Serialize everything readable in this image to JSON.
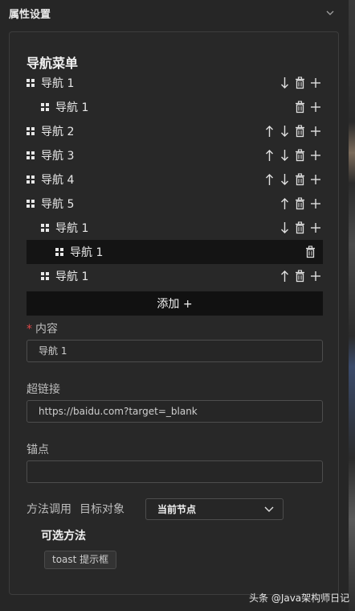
{
  "header": {
    "title": "属性设置"
  },
  "menu": {
    "title": "导航菜单",
    "items": [
      {
        "label": "导航 1",
        "level": 0,
        "up": false,
        "down": true,
        "add": true,
        "selected": false
      },
      {
        "label": "导航 1",
        "level": 1,
        "up": false,
        "down": false,
        "add": true,
        "selected": false
      },
      {
        "label": "导航 2",
        "level": 0,
        "up": true,
        "down": true,
        "add": true,
        "selected": false
      },
      {
        "label": "导航 3",
        "level": 0,
        "up": true,
        "down": true,
        "add": true,
        "selected": false
      },
      {
        "label": "导航 4",
        "level": 0,
        "up": true,
        "down": true,
        "add": true,
        "selected": false
      },
      {
        "label": "导航 5",
        "level": 0,
        "up": true,
        "down": false,
        "add": true,
        "selected": false
      },
      {
        "label": "导航 1",
        "level": 1,
        "up": false,
        "down": true,
        "add": true,
        "selected": false
      },
      {
        "label": "导航 1",
        "level": 2,
        "up": false,
        "down": false,
        "add": false,
        "selected": true
      },
      {
        "label": "导航 1",
        "level": 1,
        "up": true,
        "down": false,
        "add": true,
        "selected": false
      }
    ],
    "add_label": "添加 +"
  },
  "content": {
    "required_mark": "*",
    "label": "内容",
    "value": "导航 1"
  },
  "link": {
    "label": "超链接",
    "value": "https://baidu.com?target=_blank"
  },
  "anchor": {
    "label": "锚点",
    "value": ""
  },
  "method": {
    "label": "方法调用",
    "target_label": "目标对象",
    "target_value": "当前节点",
    "optional_title": "可选方法",
    "chip": "toast 提示框"
  },
  "watermark": "头条 @Java架构师日记",
  "icons": {
    "drag": "drag-handle-icon",
    "up": "arrow-up-icon",
    "down": "arrow-down-icon",
    "delete": "trash-icon",
    "add": "plus-icon",
    "collapse": "chevron-down-icon"
  },
  "colors": {
    "background": "#262626",
    "panel": "#282828",
    "selected_row": "#141414",
    "add_button": "#111111",
    "required": "#e04848"
  }
}
